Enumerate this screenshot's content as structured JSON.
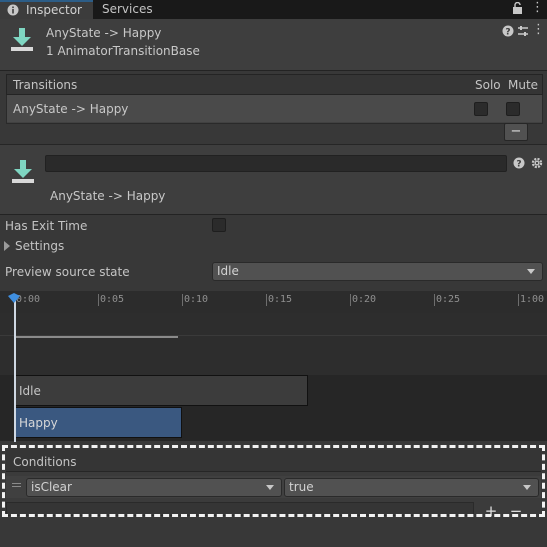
{
  "tabs": [
    {
      "label": "Inspector",
      "icon": "info-icon",
      "active": true
    },
    {
      "label": "Services",
      "icon": null,
      "active": false
    }
  ],
  "header": {
    "title": "AnyState -> Happy",
    "subtitle": "1 AnimatorTransitionBase",
    "icon": "transition-down-arrow-icon"
  },
  "transitions": {
    "header": "Transitions",
    "solo_label": "Solo",
    "mute_label": "Mute",
    "rows": [
      {
        "name": "AnyState -> Happy",
        "solo": false,
        "mute": false
      }
    ],
    "remove_label": "−"
  },
  "transition_header": {
    "name_value": "",
    "caption": "AnyState -> Happy"
  },
  "settings": {
    "has_exit_time_label": "Has Exit Time",
    "has_exit_time": false,
    "settings_label": "Settings",
    "preview_source_label": "Preview source state",
    "preview_source_value": "Idle"
  },
  "timeline": {
    "ticks": [
      "0:00",
      "0:05",
      "0:10",
      "0:15",
      "0:20",
      "0:25",
      "1:00"
    ],
    "states": [
      {
        "name": "Idle",
        "color": "#3c3c3c"
      },
      {
        "name": "Happy",
        "color": "#3a5880"
      }
    ]
  },
  "conditions": {
    "header": "Conditions",
    "items": [
      {
        "parameter": "isClear",
        "value": "true"
      }
    ],
    "add_label": "+",
    "remove_label": "−"
  },
  "colors": {
    "accent": "#2c5d87",
    "happy_state": "#3a5880",
    "icon_teal": "#7fd6c2"
  }
}
